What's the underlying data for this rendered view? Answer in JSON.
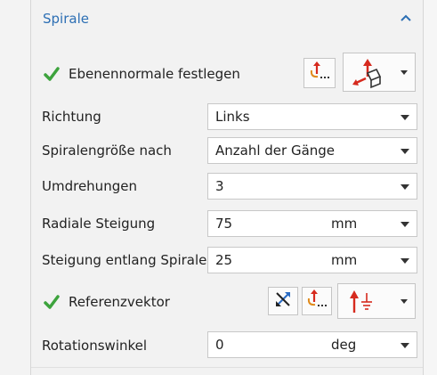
{
  "section": {
    "title": "Spirale"
  },
  "plane_normal": {
    "label": "Ebenennormale festlegen"
  },
  "rows": [
    {
      "label": "Richtung",
      "value": "Links",
      "unit": ""
    },
    {
      "label": "Spiralengröße nach",
      "value": "Anzahl der Gänge",
      "unit": ""
    },
    {
      "label": "Umdrehungen",
      "value": "3",
      "unit": ""
    },
    {
      "label": "Radiale Steigung",
      "value": "75",
      "unit": "mm"
    },
    {
      "label": "Steigung entlang Spirale",
      "value": "25",
      "unit": "mm"
    }
  ],
  "reference_vector": {
    "label": "Referenzvektor"
  },
  "rotation": {
    "label": "Rotationswinkel",
    "value": "0",
    "unit": "deg"
  },
  "colors": {
    "accent": "#2d6fb4",
    "check": "#3da33d",
    "panel": "#f2f2f2"
  },
  "icons": [
    "chevron-up-icon",
    "checkmark-icon",
    "point-dialog-icon",
    "plane-normal-icon",
    "reverse-direction-icon",
    "vector-dialog-icon",
    "vector-direction-icon",
    "dropdown-arrow-icon"
  ]
}
